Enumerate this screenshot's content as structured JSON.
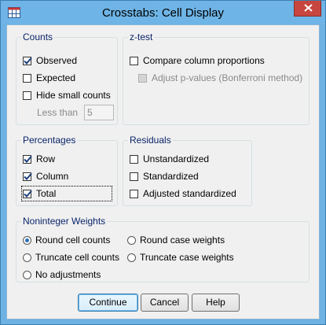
{
  "window": {
    "title": "Crosstabs: Cell Display"
  },
  "counts": {
    "title": "Counts",
    "observed": {
      "label": "Observed",
      "checked": true
    },
    "expected": {
      "label": "Expected",
      "checked": false
    },
    "hide_small": {
      "label": "Hide small counts",
      "checked": false
    },
    "less_than_label": "Less than",
    "less_than_value": "5"
  },
  "ztest": {
    "title": "z-test",
    "compare": {
      "label": "Compare column proportions",
      "checked": false
    },
    "adjust": {
      "label": "Adjust p-values (Bonferroni method)",
      "checked": false,
      "disabled": true
    }
  },
  "percentages": {
    "title": "Percentages",
    "row": {
      "label": "Row",
      "checked": true
    },
    "column": {
      "label": "Column",
      "checked": true
    },
    "total": {
      "label": "Total",
      "checked": true
    }
  },
  "residuals": {
    "title": "Residuals",
    "unstandardized": {
      "label": "Unstandardized",
      "checked": false
    },
    "standardized": {
      "label": "Standardized",
      "checked": false
    },
    "adjusted": {
      "label": "Adjusted standardized",
      "checked": false
    }
  },
  "weights": {
    "title": "Noninteger Weights",
    "options": [
      {
        "label": "Round cell counts",
        "selected": true
      },
      {
        "label": "Round case weights",
        "selected": false
      },
      {
        "label": "Truncate cell counts",
        "selected": false
      },
      {
        "label": "Truncate case weights",
        "selected": false
      },
      {
        "label": "No adjustments",
        "selected": false
      }
    ]
  },
  "buttons": {
    "continue": "Continue",
    "cancel": "Cancel",
    "help": "Help"
  },
  "colors": {
    "accent": "#2a6fb8",
    "titlebar": "#6eb4e6",
    "close": "#c7463f",
    "group_title": "#0a246a"
  }
}
